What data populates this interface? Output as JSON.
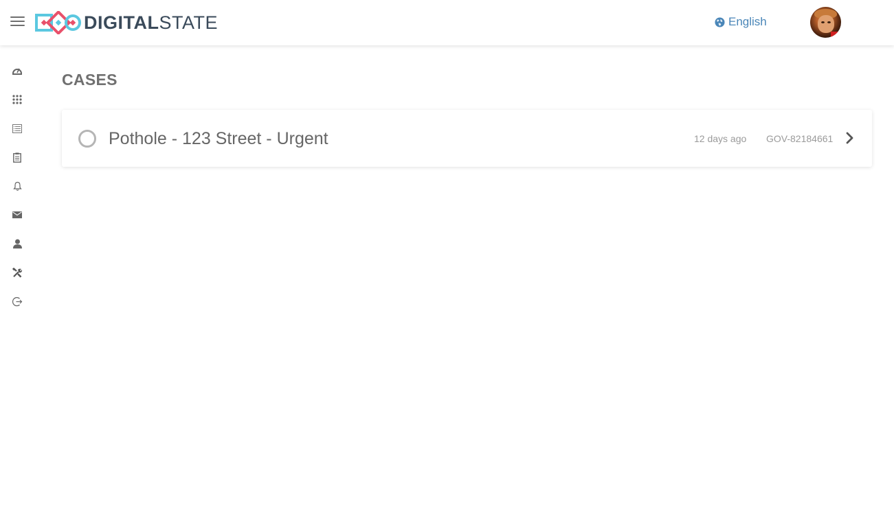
{
  "header": {
    "menu_icon": "hamburger-icon",
    "logo": {
      "text_bold": "DIGITAL",
      "text_light": "STATE",
      "colors": {
        "cyan": "#5bc8e0",
        "pink": "#e8506a",
        "text": "#3a4a5a"
      }
    },
    "language": {
      "icon": "globe-icon",
      "label": "English",
      "color": "#4a86b8"
    },
    "avatar_icon": "user-avatar"
  },
  "sidebar": {
    "items": [
      {
        "icon": "dashboard-icon"
      },
      {
        "icon": "apps-grid-icon"
      },
      {
        "icon": "list-icon"
      },
      {
        "icon": "clipboard-icon"
      },
      {
        "icon": "bell-icon"
      },
      {
        "icon": "envelope-icon"
      },
      {
        "icon": "user-icon"
      },
      {
        "icon": "tools-icon"
      },
      {
        "icon": "logout-icon"
      }
    ]
  },
  "main": {
    "title": "CASES",
    "cases": [
      {
        "status_icon": "status-circle-icon",
        "title": "Pothole - 123 Street - Urgent",
        "time": "12 days ago",
        "id": "GOV-82184661",
        "action_icon": "chevron-right-icon"
      }
    ]
  }
}
